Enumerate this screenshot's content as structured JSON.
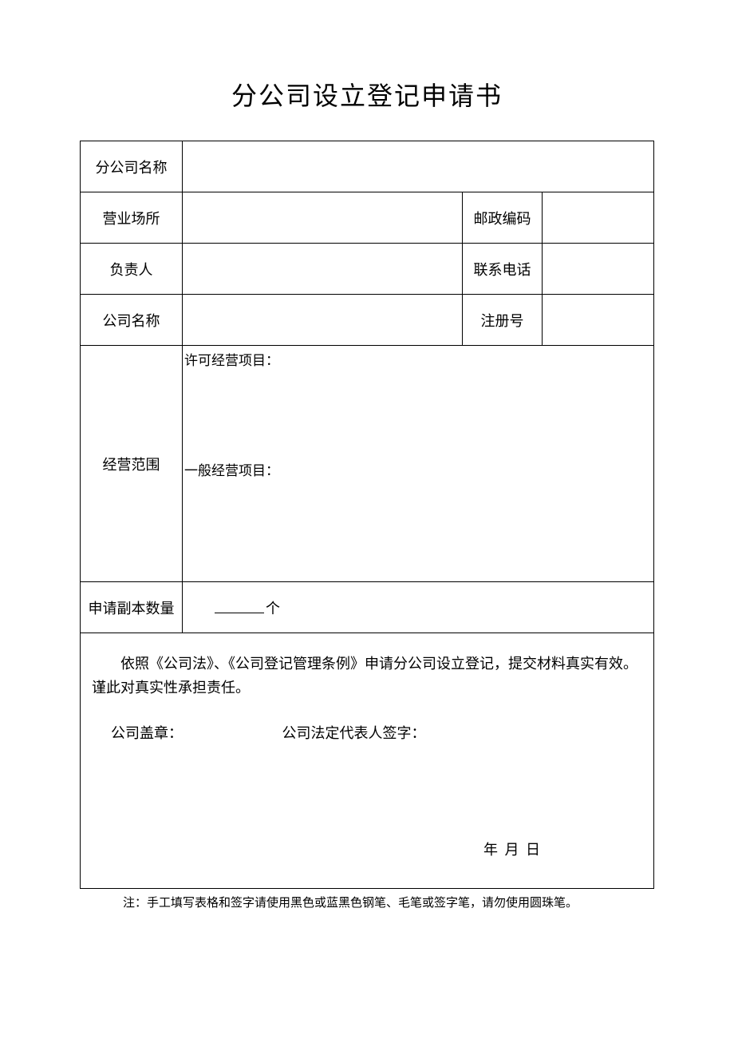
{
  "title": "分公司设立登记申请书",
  "rows": {
    "branch_name_label": "分公司名称",
    "branch_name_value": "",
    "address_label": "营业场所",
    "address_value": "",
    "postcode_label": "邮政编码",
    "postcode_value": "",
    "person_label": "负责人",
    "person_value": "",
    "phone_label": "联系电话",
    "phone_value": "",
    "company_label": "公司名称",
    "company_value": "",
    "regno_label": "注册号",
    "regno_value": "",
    "scope_label": "经营范围",
    "scope_licensed": "许可经营项目：",
    "scope_general": "一般经营项目：",
    "qty_label": "申请副本数量",
    "qty_unit": "个"
  },
  "declaration": {
    "text": "依照《公司法》、《公司登记管理条例》申请分公司设立登记，提交材料真实有效。谨此对真实性承担责任。",
    "seal": "公司盖章：",
    "rep": "公司法定代表人签字：",
    "date": "年 月 日"
  },
  "footnote": "注：手工填写表格和签字请使用黑色或蓝黑色钢笔、毛笔或签字笔，请勿使用圆珠笔。"
}
